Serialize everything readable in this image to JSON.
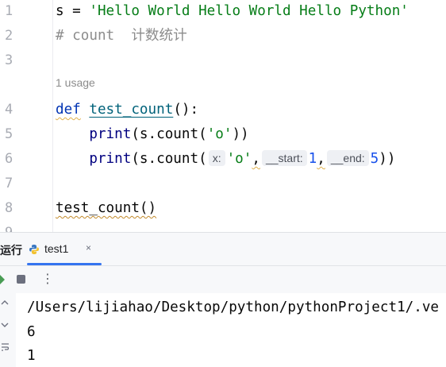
{
  "editor": {
    "line_numbers": [
      "1",
      "2",
      "3",
      "4",
      "5",
      "6",
      "7",
      "8",
      "9"
    ],
    "line1": {
      "var": "s",
      "op": " = ",
      "string": "'Hello World Hello World Hello Python'"
    },
    "line2": {
      "comment": "# count  计数统计"
    },
    "usage_hint": "1 usage",
    "line4": {
      "kw": "def",
      "fn": "test_count",
      "rest": "():"
    },
    "line5": {
      "indent": "    ",
      "builtin": "print",
      "pre": "(s.count(",
      "arg": "'o'",
      "post": "))"
    },
    "line6": {
      "indent": "    ",
      "builtin": "print",
      "pre": "(s.count(",
      "hint_x": "x:",
      "arg": "'o'",
      "sep1": ",",
      "hint_start": "__start:",
      "start_val": "1",
      "sep2": ",",
      "hint_end": "__end:",
      "end_val": "5",
      "post": "))"
    },
    "line8": {
      "call": "test_count()"
    }
  },
  "run_panel": {
    "tool_window_label": "运行",
    "tab": {
      "label": "test1",
      "close": "×"
    },
    "more_icon": "⋮"
  },
  "console": {
    "path_line": "/Users/lijiahao/Desktop/python/pythonProject1/.ve",
    "output_lines": [
      "6",
      "1"
    ]
  },
  "colors": {
    "keyword": "#0033b3",
    "string": "#067d17",
    "comment": "#8c8c8c",
    "number": "#1750eb",
    "function": "#00627a",
    "tab_underline": "#3574f0"
  }
}
